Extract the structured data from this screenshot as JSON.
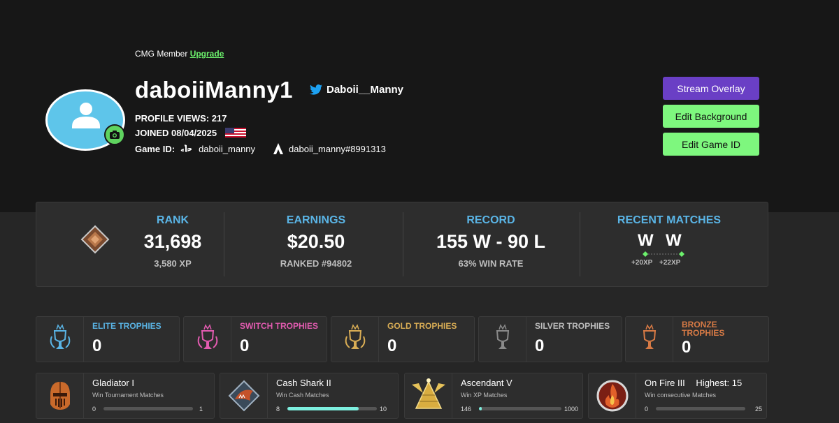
{
  "profile": {
    "member_text": "CMG Member",
    "upgrade_link": "Upgrade",
    "username": "daboiiManny1",
    "twitter_handle": "Daboii__Manny",
    "profile_views": "PROFILE VIEWS: 217",
    "joined": "JOINED 08/04/2025",
    "game_id_label": "Game ID:",
    "psn_id": "daboii_manny",
    "apex_id": "daboii_manny#8991313"
  },
  "buttons": {
    "stream_overlay": "Stream Overlay",
    "edit_background": "Edit Background",
    "edit_game_id": "Edit Game ID"
  },
  "stats": {
    "rank": {
      "label": "RANK",
      "value": "31,698",
      "sub": "3,580 XP"
    },
    "earnings": {
      "label": "EARNINGS",
      "value": "$20.50",
      "sub": "RANKED #94802"
    },
    "record": {
      "label": "RECORD",
      "value": "155 W - 90 L",
      "sub": "63% WIN RATE"
    },
    "recent": {
      "label": "RECENT MATCHES",
      "matches": [
        "W",
        "W"
      ],
      "xp": [
        "+20XP",
        "+22XP"
      ]
    }
  },
  "trophies": [
    {
      "label": "ELITE TROPHIES",
      "count": "0",
      "color": "#5ab4e5"
    },
    {
      "label": "SWITCH TROPHIES",
      "count": "0",
      "color": "#e25bb0"
    },
    {
      "label": "GOLD TROPHIES",
      "count": "0",
      "color": "#d9ad55"
    },
    {
      "label": "SILVER TROPHIES",
      "count": "0",
      "color": "#bdbdbd"
    },
    {
      "label_line1": "BRONZE",
      "label_line2": "TROPHIES",
      "count": "0",
      "color": "#d77a45"
    }
  ],
  "achievements": [
    {
      "name": "Gladiator I",
      "desc": "Win Tournament Matches",
      "low": "0",
      "high": "1",
      "progress": 0
    },
    {
      "name": "Cash Shark II",
      "desc": "Win Cash Matches",
      "low": "8",
      "high": "10",
      "progress": 0.8
    },
    {
      "name": "Ascendant V",
      "desc": "Win XP Matches",
      "low": "146",
      "high": "1000",
      "progress": 0.03
    },
    {
      "name": "On Fire III",
      "highest": "Highest: 15",
      "desc": "Win consecutive Matches",
      "low": "0",
      "high": "25",
      "progress": 0
    }
  ]
}
